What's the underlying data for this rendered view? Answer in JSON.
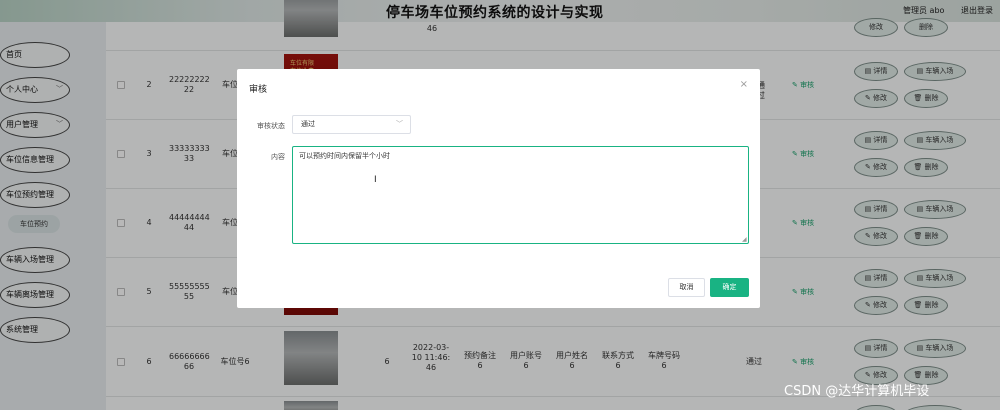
{
  "header": {
    "title": "停车场车位预约系统的设计与实现",
    "user": "管理员 abo",
    "logout": "退出登录"
  },
  "sidebar": {
    "items": [
      {
        "label": "首页",
        "has_chevron": false
      },
      {
        "label": "个人中心",
        "has_chevron": true
      },
      {
        "label": "用户管理",
        "has_chevron": true
      },
      {
        "label": "车位信息管理",
        "has_chevron": true
      },
      {
        "label": "车位预约管理",
        "has_chevron": true
      },
      {
        "label": "车辆入场管理",
        "has_chevron": true
      },
      {
        "label": "车辆离场管理",
        "has_chevron": true
      },
      {
        "label": "系统管理",
        "has_chevron": true
      }
    ],
    "subitem": "车位预约"
  },
  "table": {
    "top_partial_value": "46",
    "rows": [
      {
        "index": "2",
        "account": "22222222\n22",
        "spot": "车位号",
        "image": "red",
        "image_text": "车位有限\n车位收费"
      },
      {
        "index": "3",
        "account": "33333333\n33",
        "spot": "车位号"
      },
      {
        "index": "4",
        "account": "44444444\n44",
        "spot": "车位号"
      },
      {
        "index": "5",
        "account": "55555555\n55",
        "spot": "车位号"
      },
      {
        "index": "6",
        "account": "66666666\n66",
        "spot": "车位号6",
        "count": "6",
        "time": "2022-03-\n10 11:46:\n46",
        "remark": "预约备注\n6",
        "username": "用户账号\n6",
        "name": "用户姓名\n6",
        "contact": "联系方式\n6",
        "plate": "车牌号码\n6",
        "status": "通过"
      }
    ],
    "audit_label": "审核",
    "buttons": {
      "detail": "详情",
      "enter": "车辆入场",
      "edit": "修改",
      "delete": "删除"
    },
    "top_buttons": {
      "edit": "修改",
      "delete": "删除"
    },
    "side_status": "通过"
  },
  "modal": {
    "title": "审核",
    "close": "×",
    "status_label": "审核状态",
    "status_value": "通过",
    "content_label": "内容",
    "content_value": "可以预约时间内保留半个小时",
    "cancel": "取消",
    "confirm": "确定"
  },
  "watermark": "CSDN @达华计算机毕设",
  "colors": {
    "accent": "#19b383",
    "link": "#19a06b"
  }
}
